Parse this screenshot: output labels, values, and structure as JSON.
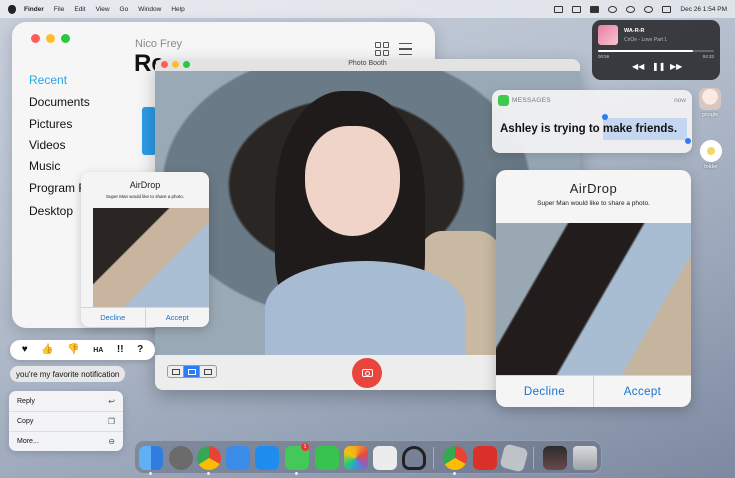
{
  "menubar": {
    "app": "Finder",
    "items": [
      "File",
      "Edit",
      "View",
      "Go",
      "Window",
      "Help"
    ],
    "datetime": "Dec 26 1:54 PM"
  },
  "finder": {
    "user": "Nico Frey",
    "title": "Re",
    "sidebar": [
      "Recent",
      "Documents",
      "Pictures",
      "Videos",
      "Music",
      "Program F",
      "Desktop"
    ],
    "active_index": 0
  },
  "photobooth": {
    "title": "Photo Booth"
  },
  "airdrop_small": {
    "title": "AirDrop",
    "subtitle": "Super Man would like to share a photo.",
    "decline": "Decline",
    "accept": "Accept"
  },
  "airdrop_big": {
    "title": "AirDrop",
    "subtitle": "Super Man would like to share a photo.",
    "decline": "Decline",
    "accept": "Accept"
  },
  "now_playing": {
    "title": "WA-R-R",
    "artist": "CriOe - Love Part 1",
    "elapsed": "00:56",
    "remaining": "04:33",
    "progress": 0.82
  },
  "message": {
    "app": "MESSAGES",
    "time": "now",
    "body": "Ashley is trying to make friends."
  },
  "desktop_items": [
    {
      "label": "google"
    },
    {
      "label": "folder"
    }
  ],
  "reactions": [
    "♥",
    "👍",
    "👎",
    "HA",
    "!!",
    "?"
  ],
  "bubble": "you're my favorite notification",
  "context_menu": [
    {
      "label": "Reply",
      "icon": "reply-icon"
    },
    {
      "label": "Copy",
      "icon": "copy-icon"
    },
    {
      "label": "More...",
      "icon": "more-icon"
    }
  ],
  "dock": {
    "badge_count": "1",
    "apps": [
      "Finder",
      "Launchpad",
      "Chrome",
      "Mail",
      "App Store",
      "Messages",
      "FaceTime",
      "Photos",
      "Reminders",
      "Headphones",
      "Chrome",
      "Roblox Studio",
      "Roblox",
      "Photo",
      "Trash"
    ]
  }
}
